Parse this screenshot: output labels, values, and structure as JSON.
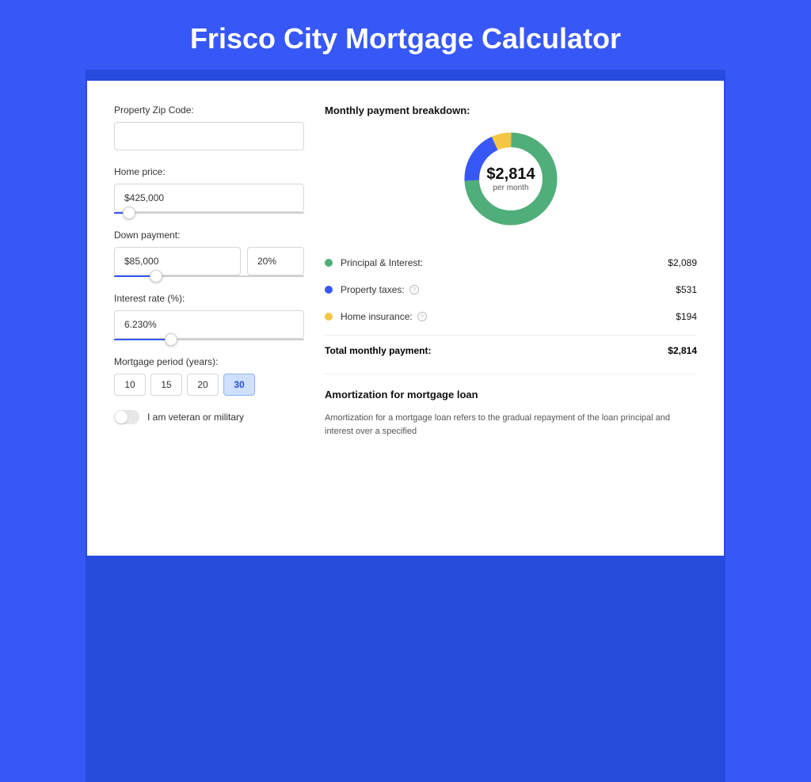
{
  "title": "Frisco City Mortgage Calculator",
  "form": {
    "zip": {
      "label": "Property Zip Code:",
      "value": ""
    },
    "home_price": {
      "label": "Home price:",
      "value": "$425,000",
      "slider_pct": 8
    },
    "down_payment": {
      "label": "Down payment:",
      "value": "$85,000",
      "pct": "20%",
      "slider_pct": 22
    },
    "interest_rate": {
      "label": "Interest rate (%):",
      "value": "6.230%",
      "slider_pct": 30
    },
    "period": {
      "label": "Mortgage period (years):",
      "options": [
        "10",
        "15",
        "20",
        "30"
      ],
      "selected": "30"
    },
    "veteran": {
      "label": "I am veteran or military",
      "on": false
    }
  },
  "breakdown": {
    "title": "Monthly payment breakdown:",
    "donut": {
      "amount": "$2,814",
      "sub": "per month"
    },
    "items": [
      {
        "label": "Principal & Interest:",
        "value": "$2,089",
        "color": "#4fae7a",
        "info": false
      },
      {
        "label": "Property taxes:",
        "value": "$531",
        "color": "#3757f7",
        "info": true
      },
      {
        "label": "Home insurance:",
        "value": "$194",
        "color": "#f3c744",
        "info": true
      }
    ],
    "total": {
      "label": "Total monthly payment:",
      "value": "$2,814"
    }
  },
  "amortization": {
    "title": "Amortization for mortgage loan",
    "text": "Amortization for a mortgage loan refers to the gradual repayment of the loan principal and interest over a specified"
  },
  "colors": {
    "green": "#4fae7a",
    "blue": "#3757f7",
    "yellow": "#f3c744"
  },
  "chart_data": {
    "type": "pie",
    "title": "Monthly payment breakdown",
    "series": [
      {
        "name": "Principal & Interest",
        "value": 2089,
        "color": "#4fae7a"
      },
      {
        "name": "Property taxes",
        "value": 531,
        "color": "#3757f7"
      },
      {
        "name": "Home insurance",
        "value": 194,
        "color": "#f3c744"
      }
    ],
    "total": 2814,
    "center_label": "$2,814 per month"
  }
}
